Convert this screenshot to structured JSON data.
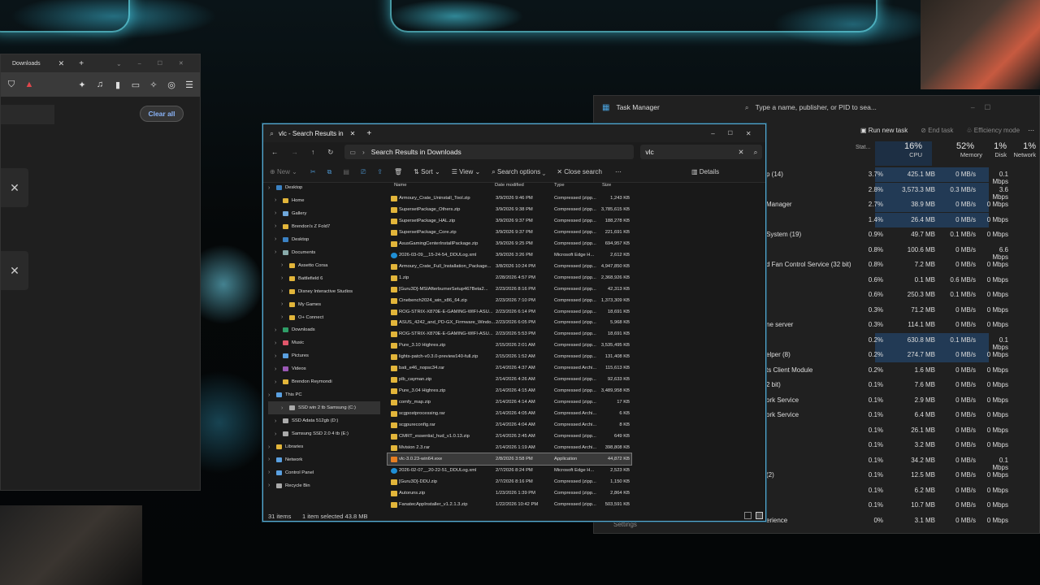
{
  "browser": {
    "tab_label": "Downloads",
    "clear_all": "Clear all"
  },
  "task_manager": {
    "title": "Task Manager",
    "search_placeholder": "Type a name, publisher, or PID to sea...",
    "run_new_task": "Run new task",
    "end_task": "End task",
    "efficiency_mode": "Efficiency mode",
    "status_col": "Stat...",
    "cpu_pct": "16%",
    "cpu_label": "CPU",
    "mem_pct": "52%",
    "mem_label": "Memory",
    "disk_pct": "1%",
    "disk_label": "Disk",
    "net_pct": "1%",
    "net_label": "Network",
    "settings": "Settings",
    "rows": [
      {
        "name": "p (14)",
        "cpu": "3.7%",
        "mem": "425.1 MB",
        "disk": "0 MB/s",
        "net": "0.1 Mbps"
      },
      {
        "name": "",
        "cpu": "2.8%",
        "mem": "3,573.3 MB",
        "disk": "0.3 MB/s",
        "net": "3.6 Mbps"
      },
      {
        "name": "Manager",
        "cpu": "2.7%",
        "mem": "38.9 MB",
        "disk": "0 MB/s",
        "net": "0 Mbps"
      },
      {
        "name": "",
        "cpu": "1.4%",
        "mem": "26.4 MB",
        "disk": "0 MB/s",
        "net": "0 Mbps"
      },
      {
        "name": "System (19)",
        "cpu": "0.9%",
        "mem": "49.7 MB",
        "disk": "0.1 MB/s",
        "net": "0 Mbps"
      },
      {
        "name": "",
        "cpu": "0.8%",
        "mem": "100.6 MB",
        "disk": "0 MB/s",
        "net": "6.6 Mbps"
      },
      {
        "name": "d Fan Control Service (32 bit)",
        "cpu": "0.8%",
        "mem": "7.2 MB",
        "disk": "0 MB/s",
        "net": "0 Mbps"
      },
      {
        "name": "",
        "cpu": "0.6%",
        "mem": "0.1 MB",
        "disk": "0.6 MB/s",
        "net": "0 Mbps"
      },
      {
        "name": "",
        "cpu": "0.6%",
        "mem": "250.3 MB",
        "disk": "0.1 MB/s",
        "net": "0 Mbps"
      },
      {
        "name": "",
        "cpu": "0.3%",
        "mem": "71.2 MB",
        "disk": "0 MB/s",
        "net": "0 Mbps"
      },
      {
        "name": "ne server",
        "cpu": "0.3%",
        "mem": "114.1 MB",
        "disk": "0 MB/s",
        "net": "0 Mbps"
      },
      {
        "name": "",
        "cpu": "0.2%",
        "mem": "630.8 MB",
        "disk": "0.1 MB/s",
        "net": "0.1 Mbps"
      },
      {
        "name": "elper (8)",
        "cpu": "0.2%",
        "mem": "274.7 MB",
        "disk": "0 MB/s",
        "net": "0 Mbps"
      },
      {
        "name": "ts Client Module",
        "cpu": "0.2%",
        "mem": "1.6 MB",
        "disk": "0 MB/s",
        "net": "0 Mbps"
      },
      {
        "name": "2 bit)",
        "cpu": "0.1%",
        "mem": "7.6 MB",
        "disk": "0 MB/s",
        "net": "0 Mbps"
      },
      {
        "name": "ork Service",
        "cpu": "0.1%",
        "mem": "2.9 MB",
        "disk": "0 MB/s",
        "net": "0 Mbps"
      },
      {
        "name": "ork Service",
        "cpu": "0.1%",
        "mem": "6.4 MB",
        "disk": "0 MB/s",
        "net": "0 Mbps"
      },
      {
        "name": "",
        "cpu": "0.1%",
        "mem": "26.1 MB",
        "disk": "0 MB/s",
        "net": "0 Mbps"
      },
      {
        "name": "",
        "cpu": "0.1%",
        "mem": "3.2 MB",
        "disk": "0 MB/s",
        "net": "0 Mbps"
      },
      {
        "name": "",
        "cpu": "0.1%",
        "mem": "34.2 MB",
        "disk": "0 MB/s",
        "net": "0.1 Mbps"
      },
      {
        "name": "(2)",
        "cpu": "0.1%",
        "mem": "12.5 MB",
        "disk": "0 MB/s",
        "net": "0 Mbps"
      },
      {
        "name": "",
        "cpu": "0.1%",
        "mem": "6.2 MB",
        "disk": "0 MB/s",
        "net": "0 Mbps"
      },
      {
        "name": "",
        "cpu": "0.1%",
        "mem": "10.7 MB",
        "disk": "0 MB/s",
        "net": "0 Mbps"
      },
      {
        "name": "erience",
        "cpu": "0%",
        "mem": "3.1 MB",
        "disk": "0 MB/s",
        "net": "0 Mbps"
      }
    ]
  },
  "explorer": {
    "tab_title": "vlc - Search Results in",
    "breadcrumb": "Search Results in Downloads",
    "search_value": "vlc",
    "cmd": {
      "new": "New",
      "sort": "Sort",
      "view": "View",
      "search_options": "Search options",
      "close_search": "Close search",
      "details": "Details"
    },
    "columns": {
      "name": "Name",
      "date": "Date modified",
      "type": "Type",
      "size": "Size"
    },
    "nav": [
      "Desktop",
      "Home",
      "Gallery",
      "Brendon's Z Fold7",
      "Desktop",
      "Documents",
      "Assetto Corsa",
      "Battlefield 6",
      "Disney Interactive Studios",
      "My Games",
      "O+ Connect",
      "Downloads",
      "Music",
      "Pictures",
      "Videos",
      "Brendon Reymondi",
      "This PC",
      "SSD win 2 tb Samsung (C:)",
      "SSD Adata 512gb (D:)",
      "Samsung SSD 2.0 4 tb (E:)",
      "Libraries",
      "Network",
      "Control Panel",
      "Recycle Bin"
    ],
    "files": [
      {
        "name": "Armoury_Crate_Uninstall_Tool.zip",
        "date": "3/9/2026 9:46 PM",
        "type": "Compressed (zipp...",
        "size": "1,243 KB",
        "icon": "zip"
      },
      {
        "name": "SupersetPackage_Others.zip",
        "date": "3/9/2026 9:38 PM",
        "type": "Compressed (zipp...",
        "size": "3,785,615 KB",
        "icon": "zip"
      },
      {
        "name": "SupersetPackage_HAL.zip",
        "date": "3/9/2026 9:37 PM",
        "type": "Compressed (zipp...",
        "size": "188,278 KB",
        "icon": "zip"
      },
      {
        "name": "SupersetPackage_Core.zip",
        "date": "3/9/2026 9:37 PM",
        "type": "Compressed (zipp...",
        "size": "221,691 KB",
        "icon": "zip"
      },
      {
        "name": "AsusGamingCenterInstallPackage.zip",
        "date": "3/9/2026 9:25 PM",
        "type": "Compressed (zipp...",
        "size": "694,957 KB",
        "icon": "zip"
      },
      {
        "name": "2026-03-09__15-24-54_DDULog.xml",
        "date": "3/9/2026 3:26 PM",
        "type": "Microsoft Edge H...",
        "size": "2,612 KB",
        "icon": "edge"
      },
      {
        "name": "Armoury_Crate_Full_Installation_Package...",
        "date": "3/8/2026 10:24 PM",
        "type": "Compressed (zipp...",
        "size": "4,947,850 KB",
        "icon": "zip"
      },
      {
        "name": "1.zip",
        "date": "2/28/2026 4:57 PM",
        "type": "Compressed (zipp...",
        "size": "2,368,926 KB",
        "icon": "zip"
      },
      {
        "name": "[Guru3D]-MSIAfterburnerSetup467Beta2...",
        "date": "2/23/2026 8:16 PM",
        "type": "Compressed (zipp...",
        "size": "42,313 KB",
        "icon": "zip"
      },
      {
        "name": "Cinebench2024_win_x86_64.zip",
        "date": "2/23/2026 7:10 PM",
        "type": "Compressed (zipp...",
        "size": "1,373,309 KB",
        "icon": "zip"
      },
      {
        "name": "ROG-STRIX-X870E-E-GAMING-WIFI-ASU...",
        "date": "2/23/2026 6:14 PM",
        "type": "Compressed (zipp...",
        "size": "18,691 KB",
        "icon": "zip"
      },
      {
        "name": "ASUS_4242_and_PD-GX_Firmware_Windo...",
        "date": "2/23/2026 6:05 PM",
        "type": "Compressed (zipp...",
        "size": "5,968 KB",
        "icon": "zip"
      },
      {
        "name": "ROG-STRIX-X870E-E-GAMING-WIFI-ASU...",
        "date": "2/23/2026 5:53 PM",
        "type": "Compressed (zipp...",
        "size": "18,691 KB",
        "icon": "zip"
      },
      {
        "name": "Pure_3.10 Highres.zip",
        "date": "2/15/2026 2:01 AM",
        "type": "Compressed (zipp...",
        "size": "3,535,495 KB",
        "icon": "zip"
      },
      {
        "name": "lights-patch-v0.3.0-preview140-full.zip",
        "date": "2/15/2026 1:52 AM",
        "type": "Compressed (zipp...",
        "size": "131,408 KB",
        "icon": "zip"
      },
      {
        "name": "bati_e46_nopsc34.rar",
        "date": "2/14/2026 4:37 AM",
        "type": "Compressed Archi...",
        "size": "115,613 KB",
        "icon": "zip"
      },
      {
        "name": "plb_cayman.zip",
        "date": "2/14/2026 4:26 AM",
        "type": "Compressed (zipp...",
        "size": "92,633 KB",
        "icon": "zip"
      },
      {
        "name": "Pure_3.04 Highres.zip",
        "date": "2/14/2026 4:15 AM",
        "type": "Compressed (zipp...",
        "size": "3,489,958 KB",
        "icon": "zip"
      },
      {
        "name": "comfy_map.zip",
        "date": "2/14/2026 4:14 AM",
        "type": "Compressed (zipp...",
        "size": "17 KB",
        "icon": "zip"
      },
      {
        "name": "scgpostprocessing.rar",
        "date": "2/14/2026 4:05 AM",
        "type": "Compressed Archi...",
        "size": "6 KB",
        "icon": "zip"
      },
      {
        "name": "scgpureconfig.rar",
        "date": "2/14/2026 4:04 AM",
        "type": "Compressed Archi...",
        "size": "8 KB",
        "icon": "zip"
      },
      {
        "name": "CMRT_essential_hud_v1.0.13.zip",
        "date": "2/14/2026 2:45 AM",
        "type": "Compressed (zipp...",
        "size": "649 KB",
        "icon": "zip"
      },
      {
        "name": "Mvision 2.3.rar",
        "date": "2/14/2026 1:19 AM",
        "type": "Compressed Archi...",
        "size": "398,808 KB",
        "icon": "zip"
      },
      {
        "name": "vlc-3.0.23-win64.exe",
        "date": "2/8/2026 3:58 PM",
        "type": "Application",
        "size": "44,872 KB",
        "icon": "app",
        "selected": true
      },
      {
        "name": "2026-02-07__20-22-51_DDULog.xml",
        "date": "2/7/2026 8:24 PM",
        "type": "Microsoft Edge H...",
        "size": "2,523 KB",
        "icon": "edge"
      },
      {
        "name": "[Guru3D]-DDU.zip",
        "date": "2/7/2026 8:16 PM",
        "type": "Compressed (zipp...",
        "size": "1,150 KB",
        "icon": "zip"
      },
      {
        "name": "Autoruns.zip",
        "date": "1/23/2026 1:39 PM",
        "type": "Compressed (zipp...",
        "size": "2,864 KB",
        "icon": "zip"
      },
      {
        "name": "FanatecAppInstaller_v1.2.1.3.zip",
        "date": "1/22/2026 10:42 PM",
        "type": "Compressed (zipp...",
        "size": "503,591 KB",
        "icon": "zip"
      }
    ],
    "status": {
      "count": "31 items",
      "selected": "1 item selected  43.8 MB"
    }
  }
}
